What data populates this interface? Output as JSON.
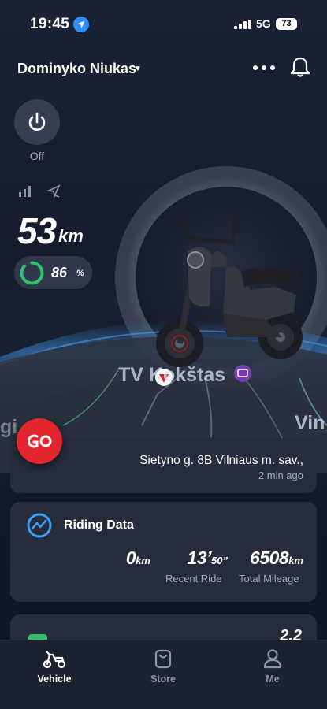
{
  "status_bar": {
    "time": "19:45",
    "network": "5G",
    "battery": "73"
  },
  "header": {
    "user_name": "Dominyko Niukas"
  },
  "vehicle": {
    "power_state": "Off",
    "range_value": "53",
    "range_unit": "km",
    "battery_percent": "86",
    "battery_unit": "%",
    "battery_level": 0.86
  },
  "map": {
    "labels": [
      "TV Kokštas",
      "Vin",
      "gi"
    ]
  },
  "location": {
    "address": "Sietyno g. 8B Vilniaus m. sav.,",
    "updated": "2 min ago"
  },
  "riding_data": {
    "title": "Riding Data",
    "last_distance": "0",
    "last_distance_unit": "km",
    "recent_ride_min": "13",
    "recent_ride_sec": "50",
    "recent_ride_label": "Recent Ride",
    "total_mileage": "6508",
    "total_mileage_unit": "km",
    "total_mileage_label": "Total Mileage"
  },
  "next_card": {
    "value": "2.2"
  },
  "tabs": [
    {
      "label": "Vehicle",
      "icon": "scooter-icon",
      "active": true
    },
    {
      "label": "Store",
      "icon": "bag-icon",
      "active": false
    },
    {
      "label": "Me",
      "icon": "person-icon",
      "active": false
    }
  ],
  "colors": {
    "accent_red": "#e32530",
    "battery_green": "#2fc16b",
    "background": "#151c2c",
    "card": "#262c3b"
  }
}
